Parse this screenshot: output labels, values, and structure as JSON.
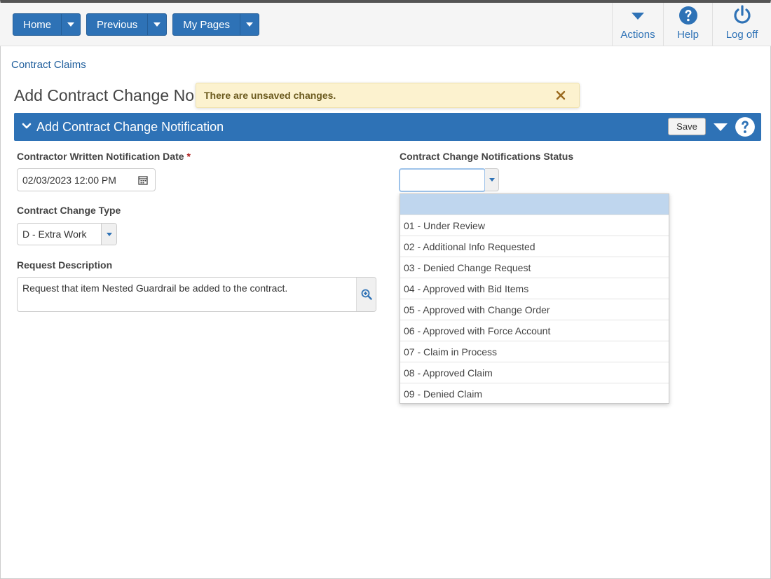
{
  "topnav": {
    "home_label": "Home",
    "previous_label": "Previous",
    "mypages_label": "My Pages",
    "actions_label": "Actions",
    "help_label": "Help",
    "logoff_label": "Log off"
  },
  "breadcrumb": "Contract Claims",
  "page_title": "Add Contract Change No",
  "toast": {
    "message": "There are unsaved changes."
  },
  "section": {
    "title": "Add Contract Change Notification",
    "save_label": "Save"
  },
  "form": {
    "notif_date_label": "Contractor Written Notification Date",
    "required_mark": "*",
    "notif_date_value": "02/03/2023 12:00 PM",
    "change_type_label": "Contract Change Type",
    "change_type_value": "D - Extra Work",
    "request_desc_label": "Request Description",
    "request_desc_value": "Request that item Nested Guardrail be added to the contract.",
    "status_label": "Contract Change Notifications Status",
    "status_value": ""
  },
  "status_options": [
    "",
    "01 - Under Review",
    "02 - Additional Info Requested",
    "03 - Denied Change Request",
    "04 - Approved with Bid Items",
    "05 - Approved with Change Order",
    "06 - Approved with Force Account",
    "07 - Claim in Process",
    "08 - Approved Claim",
    "09 - Denied Claim"
  ],
  "colors": {
    "primary_blue": "#2e72b6",
    "toast_bg": "#fcf2cf",
    "selected_option": "#bfd6ee"
  }
}
